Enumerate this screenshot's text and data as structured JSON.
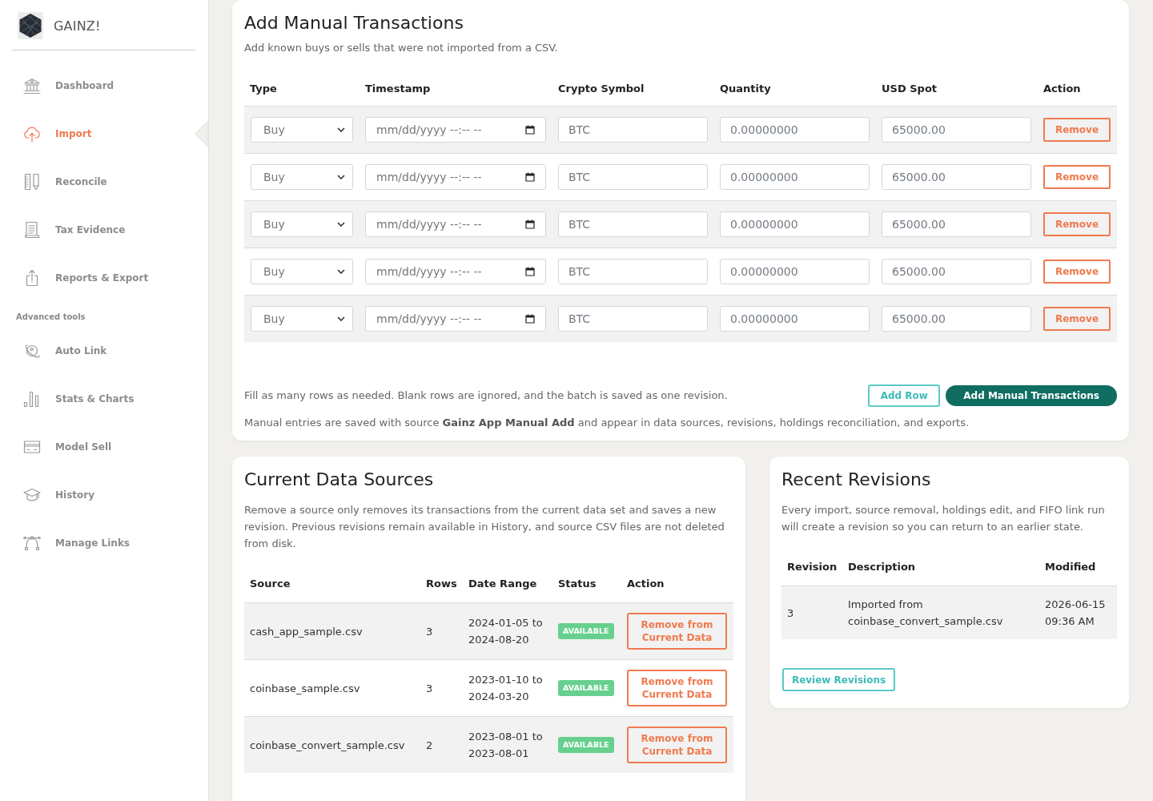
{
  "sidebar": {
    "brand": "GAINZ!",
    "groups": [
      {
        "items": [
          {
            "label": "Dashboard",
            "selected": false
          },
          {
            "label": "Import",
            "selected": true
          },
          {
            "label": "Reconcile",
            "selected": false
          },
          {
            "label": "Tax Evidence",
            "selected": false
          },
          {
            "label": "Reports & Export",
            "selected": false
          }
        ]
      },
      {
        "heading": "Advanced tools",
        "items": [
          {
            "label": "Auto Link",
            "selected": false
          },
          {
            "label": "Stats & Charts",
            "selected": false
          },
          {
            "label": "Model Sell",
            "selected": false
          },
          {
            "label": "History",
            "selected": false
          },
          {
            "label": "Manage Links",
            "selected": false
          }
        ]
      }
    ]
  },
  "manual_transactions": {
    "title": "Add Manual Transactions",
    "subtitle": "Add known buys or sells that were not imported from a CSV.",
    "columns": [
      "Type",
      "Timestamp",
      "Crypto Symbol",
      "Quantity",
      "USD Spot",
      "Action"
    ],
    "rows": [
      {
        "type": "Buy",
        "timestamp": {
          "placeholder": "mm/dd/yyyy --:-- --"
        },
        "symbol": {
          "placeholder": "BTC"
        },
        "quantity": {
          "placeholder": "0.00000000"
        },
        "usd_spot": {
          "placeholder": "65000.00"
        },
        "action": "Remove"
      },
      {
        "type": "Buy",
        "timestamp": {
          "placeholder": "mm/dd/yyyy --:-- --"
        },
        "symbol": {
          "placeholder": "BTC"
        },
        "quantity": {
          "placeholder": "0.00000000"
        },
        "usd_spot": {
          "placeholder": "65000.00"
        },
        "action": "Remove"
      },
      {
        "type": "Buy",
        "timestamp": {
          "placeholder": "mm/dd/yyyy --:-- --"
        },
        "symbol": {
          "placeholder": "BTC"
        },
        "quantity": {
          "placeholder": "0.00000000"
        },
        "usd_spot": {
          "placeholder": "65000.00"
        },
        "action": "Remove"
      },
      {
        "type": "Buy",
        "timestamp": {
          "placeholder": "mm/dd/yyyy --:-- --"
        },
        "symbol": {
          "placeholder": "BTC"
        },
        "quantity": {
          "placeholder": "0.00000000"
        },
        "usd_spot": {
          "placeholder": "65000.00"
        },
        "action": "Remove"
      },
      {
        "type": "Buy",
        "timestamp": {
          "placeholder": "mm/dd/yyyy --:-- --"
        },
        "symbol": {
          "placeholder": "BTC"
        },
        "quantity": {
          "placeholder": "0.00000000"
        },
        "usd_spot": {
          "placeholder": "65000.00"
        },
        "action": "Remove"
      }
    ],
    "help_text": "Fill as many rows as needed. Blank rows are ignored, and the batch is saved as one revision.",
    "add_row_button": "Add Row",
    "submit_button": "Add Manual Transactions",
    "footnote": "Manual entries are saved with source **Gainz App Manual Add** and appear in data sources, revisions, holdings reconciliation, and exports."
  },
  "data_sources": {
    "title": "Current Data Sources",
    "description": "Remove a source only removes its transactions from the current data set and saves a new revision. Previous revisions remain available in History, and source CSV files are not deleted from disk.",
    "columns": [
      "Source",
      "Rows",
      "Date Range",
      "Status",
      "Action"
    ],
    "rows": [
      {
        "source": "cash_app_sample.csv",
        "rows": "3",
        "date_range": "2024-01-05 to 2024-08-20",
        "status": "AVAILABLE",
        "action": "Remove from Current Data"
      },
      {
        "source": "coinbase_sample.csv",
        "rows": "3",
        "date_range": "2023-01-10 to 2024-03-20",
        "status": "AVAILABLE",
        "action": "Remove from Current Data"
      },
      {
        "source": "coinbase_convert_sample.csv",
        "rows": "2",
        "date_range": "2023-08-01 to 2023-08-01",
        "status": "AVAILABLE",
        "action": "Remove from Current Data"
      }
    ]
  },
  "revisions": {
    "title": "Recent Revisions",
    "description": "Every import, source removal, holdings edit, and FIFO link run will create a revision so you can return to an earlier state.",
    "columns": [
      "Revision",
      "Description",
      "Modified"
    ],
    "rows": [
      {
        "revision": "3",
        "description": "Imported from coinbase_convert_sample.csv",
        "modified": "2026-06-15 09:36 AM"
      }
    ],
    "button": "Review Revisions"
  }
}
